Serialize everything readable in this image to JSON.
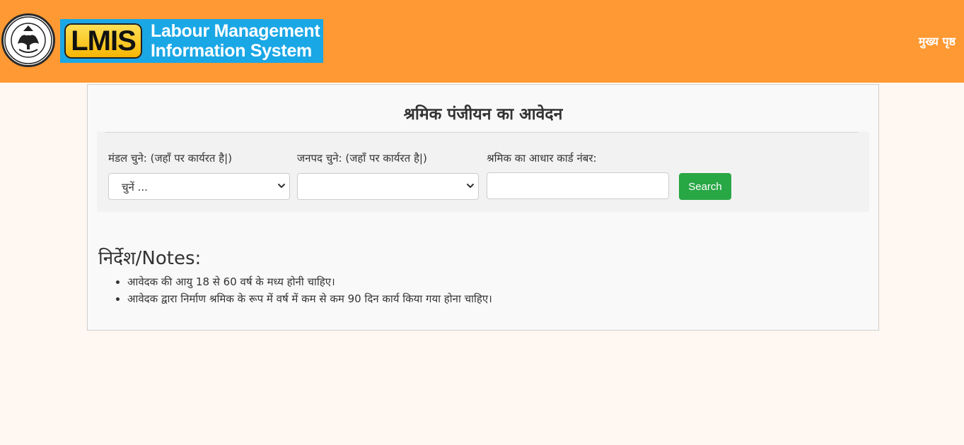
{
  "header": {
    "logo_acronym": "LMIS",
    "logo_line1": "Labour Management",
    "logo_line2": "Information System",
    "nav_home": "मुख्य पृष्ठ"
  },
  "panel": {
    "title": "श्रमिक पंजीयन का आवेदन"
  },
  "form": {
    "division_label": "मंडल चुने: (जहाँ पर कार्यरत है|)",
    "division_value": "चुनें ...",
    "district_label": "जनपद चुने: (जहाँ पर कार्यरत है|)",
    "district_value": "",
    "aadhaar_label": "श्रमिक का आधार कार्ड नंबर:",
    "aadhaar_value": "",
    "search_label": "Search"
  },
  "notes": {
    "title": "निर्देश/Notes:",
    "items": [
      "आवेदक की आयु 18 से 60 वर्ष के मध्य होनी चाहिए।",
      "आवेदक द्वारा निर्माण श्रमिक के रूप में वर्ष में कम से कम 90 दिन कार्य किया गया होना चाहिए।"
    ]
  },
  "colors": {
    "header_bg": "#ff9933",
    "logo_banner": "#1aa7e6",
    "search_button": "#28a745",
    "page_bg": "#fff7f1"
  },
  "icons": {
    "emblem": "up-government-emblem-icon",
    "select_caret": "chevron-down-icon"
  }
}
